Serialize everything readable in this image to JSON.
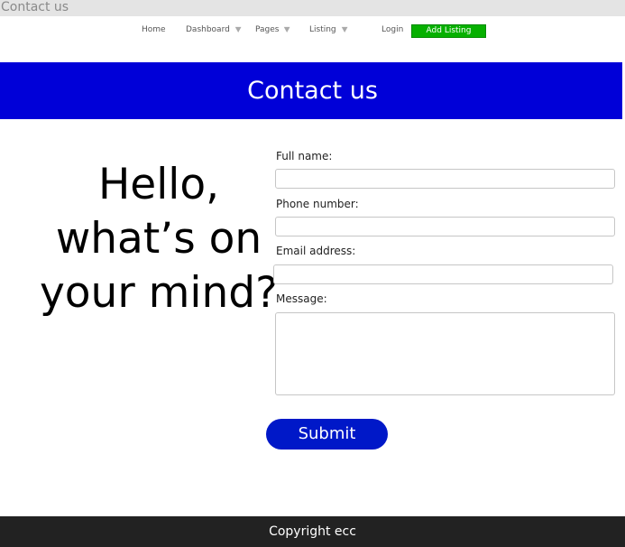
{
  "window": {
    "title": "Contact us"
  },
  "nav": {
    "home": "Home",
    "dashboard": "Dashboard",
    "pages": "Pages",
    "listing": "Listing",
    "login": "Login",
    "add_listing": "Add Listing",
    "dropdown_icon": "chevron-down-icon"
  },
  "hero": {
    "title": "Contact us"
  },
  "greeting": {
    "line1": "Hello,",
    "line2": "what’s on",
    "line3": "your mind?"
  },
  "form": {
    "full_name_label": "Full name:",
    "full_name_value": "",
    "phone_label": "Phone number:",
    "phone_value": "",
    "email_label": "Email address:",
    "email_value": "",
    "message_label": "Message:",
    "message_value": "",
    "submit_label": "Submit"
  },
  "footer": {
    "text": "Copyright ecc"
  },
  "colors": {
    "hero_background": "#0000d8",
    "add_listing_background": "#06b000",
    "submit_background": "#0018c8",
    "footer_background": "#222222"
  }
}
